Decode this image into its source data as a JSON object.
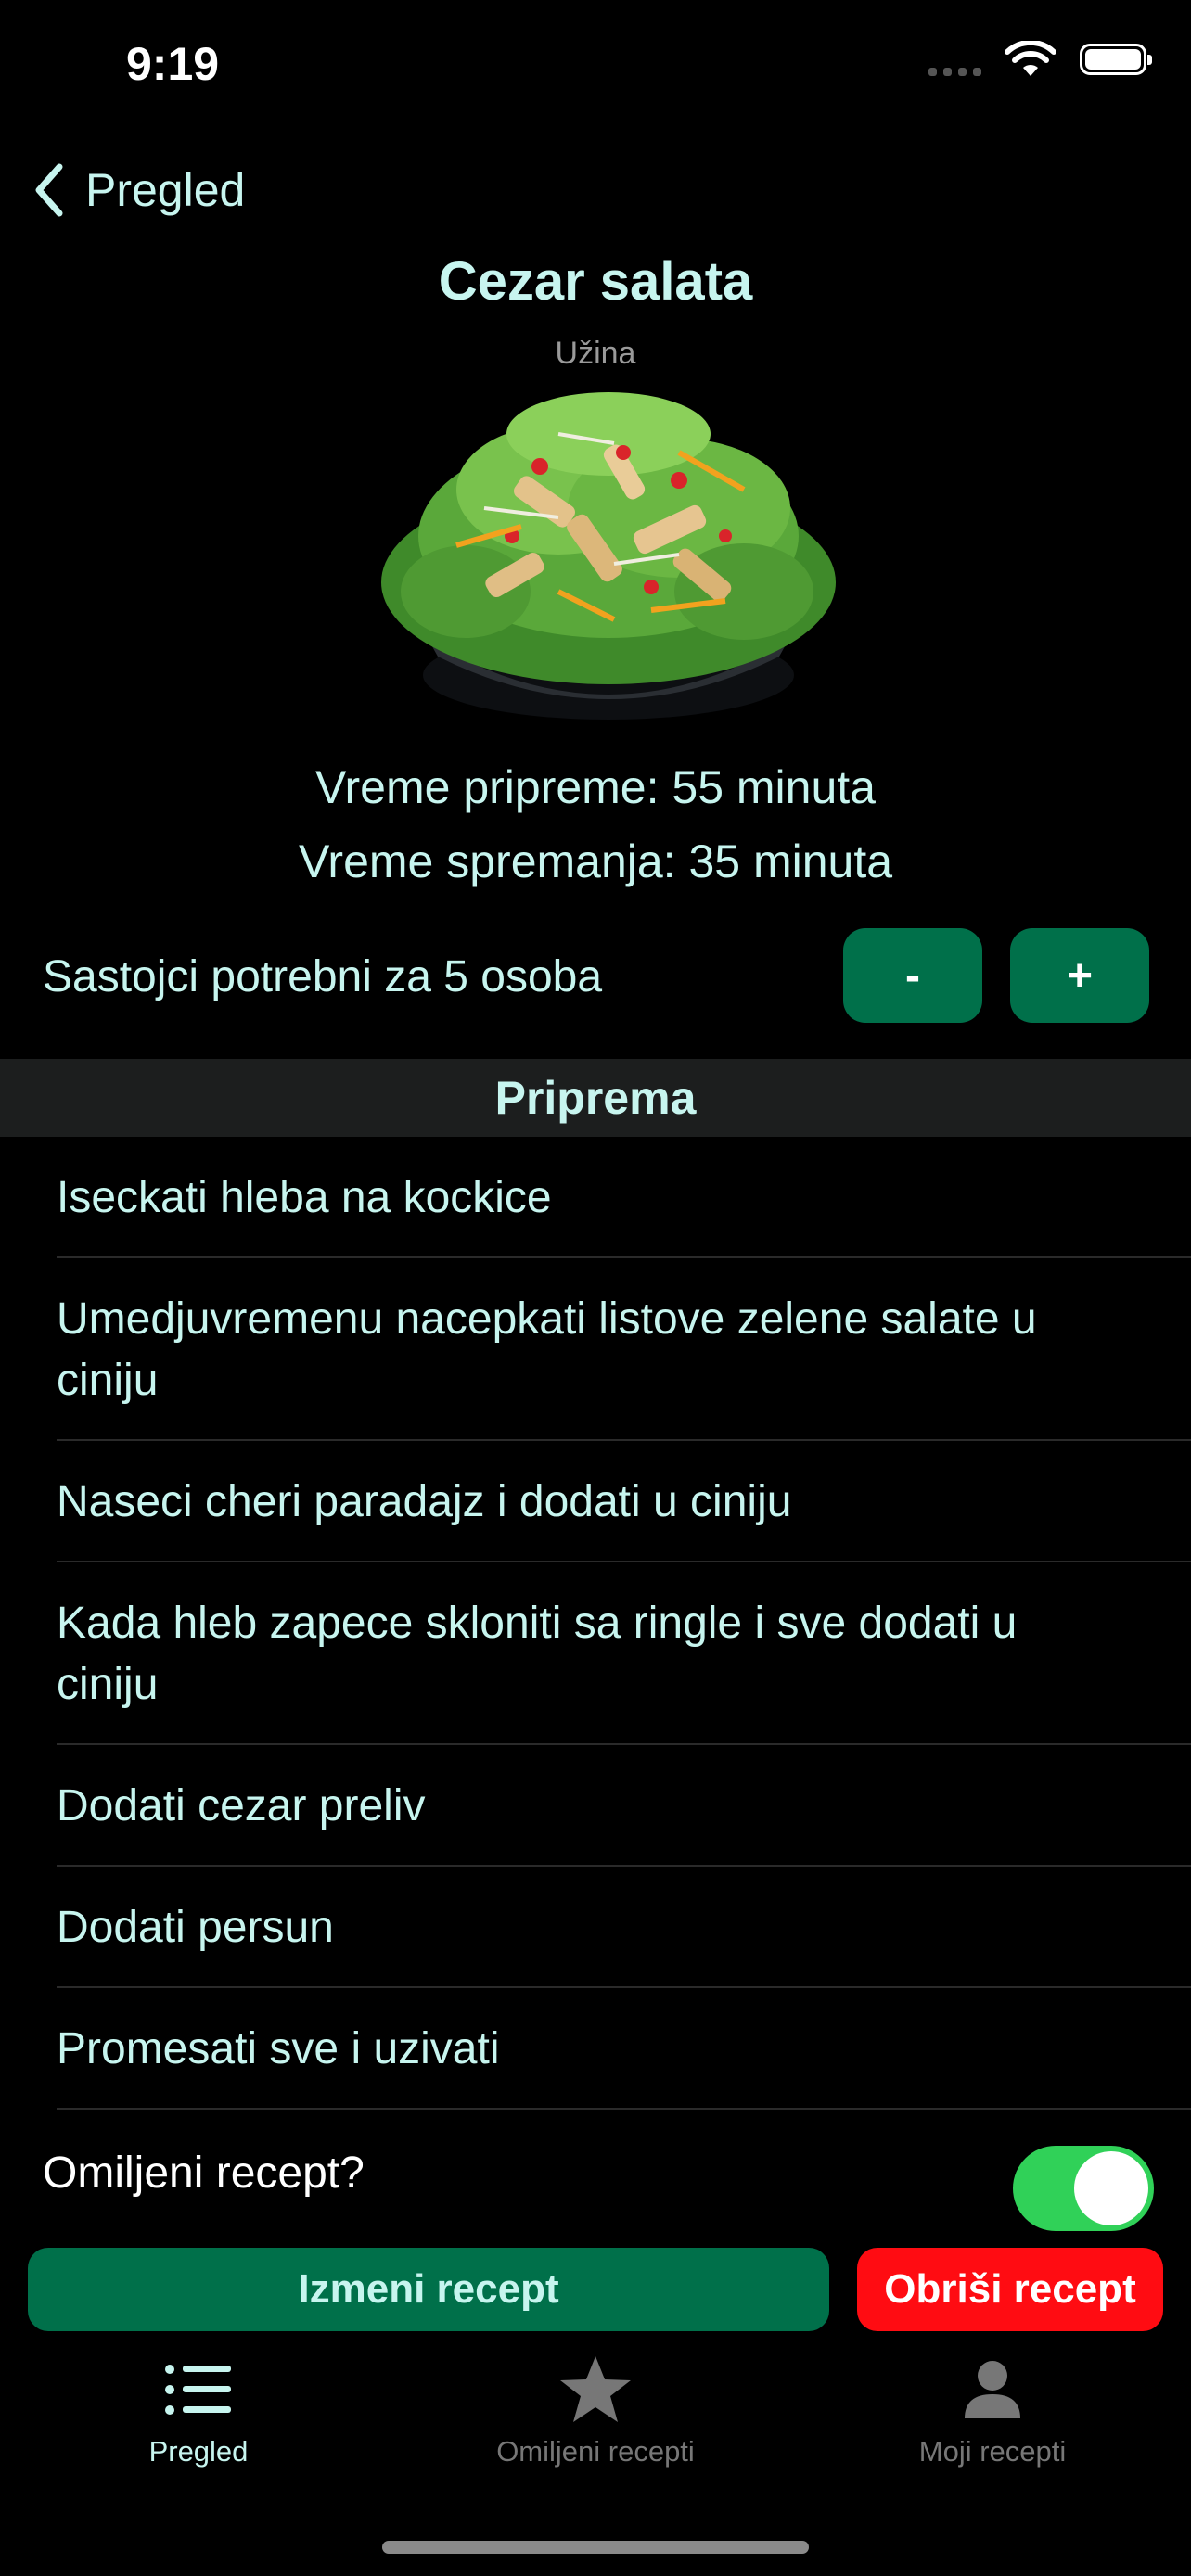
{
  "status_bar": {
    "time": "9:19"
  },
  "nav": {
    "back_label": "Pregled"
  },
  "recipe": {
    "title": "Cezar salata",
    "category": "Užina",
    "prep_time": "Vreme pripreme: 55 minuta",
    "cook_time": "Vreme spremanja: 35 minuta",
    "servings_text": "Sastojci potrebni za 5 osoba",
    "minus_label": "-",
    "plus_label": "+"
  },
  "preparation": {
    "header": "Priprema",
    "steps": [
      "Iseckati hleba na kockice",
      "Umedjuvremenu nacepkati listove zelene salate u ciniju",
      "Naseci cheri paradajz i dodati u ciniju",
      "Kada hleb zapece skloniti sa ringle i sve dodati u ciniju",
      "Dodati cezar preliv",
      "Dodati persun",
      "Promesati sve i uzivati"
    ]
  },
  "favorite": {
    "label": "Omiljeni recept?",
    "on": true
  },
  "actions": {
    "edit_label": "Izmeni recept",
    "delete_label": "Obriši recept"
  },
  "tabbar": {
    "tabs": [
      {
        "label": "Pregled",
        "icon": "list-icon",
        "active": true
      },
      {
        "label": "Omiljeni recepti",
        "icon": "star-icon",
        "active": false
      },
      {
        "label": "Moji recepti",
        "icon": "person-icon",
        "active": false
      }
    ]
  },
  "colors": {
    "accent_text": "#c7f5ef",
    "button_green": "#00704a",
    "delete_red": "#ff0c12",
    "toggle_on": "#30d158"
  }
}
